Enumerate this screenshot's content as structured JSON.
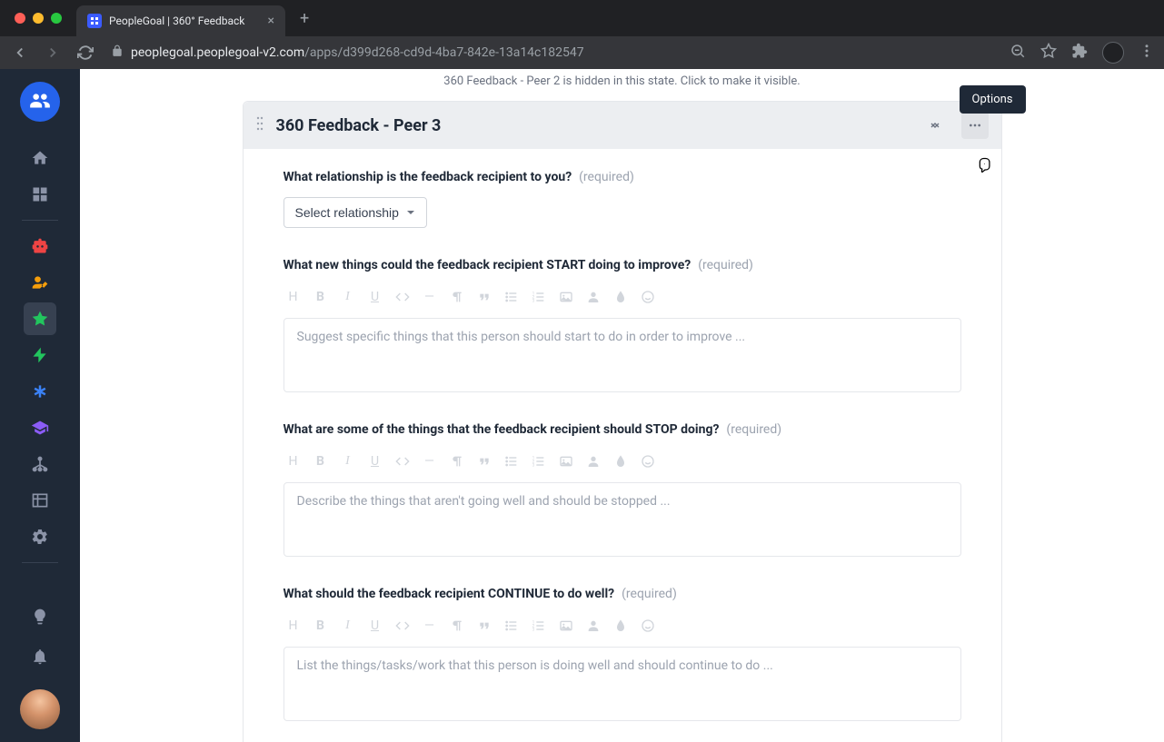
{
  "browser": {
    "tab_title": "PeopleGoal | 360° Feedback",
    "url_host": "peoplegoal.peoplegoal-v2.com",
    "url_path": "/apps/d399d268-cd9d-4ba7-842e-13a14c182547"
  },
  "banner": {
    "hidden_text": "360 Feedback - Peer 2 is hidden in this state. Click to make it visible."
  },
  "card": {
    "title": "360 Feedback - Peer 3",
    "tooltip": "Options"
  },
  "questions": {
    "relationship": {
      "label": "What relationship is the feedback recipient to you?",
      "required": "(required)",
      "select_label": "Select relationship"
    },
    "start": {
      "label": "What new things could the feedback recipient START doing to improve?",
      "required": "(required)",
      "placeholder": "Suggest specific things that this person should start to do in order to improve ..."
    },
    "stop": {
      "label": "What are some of the things that the feedback recipient should STOP doing?",
      "required": "(required)",
      "placeholder": "Describe the things that aren't going well and should be stopped ..."
    },
    "continue": {
      "label": "What should the feedback recipient CONTINUE to do well?",
      "required": "(required)",
      "placeholder": "List the things/tasks/work that this person is doing well and should continue to do ..."
    }
  },
  "rte": {
    "heading": "H",
    "bold": "B",
    "italic": "I",
    "underline": "U",
    "minus": "—"
  }
}
